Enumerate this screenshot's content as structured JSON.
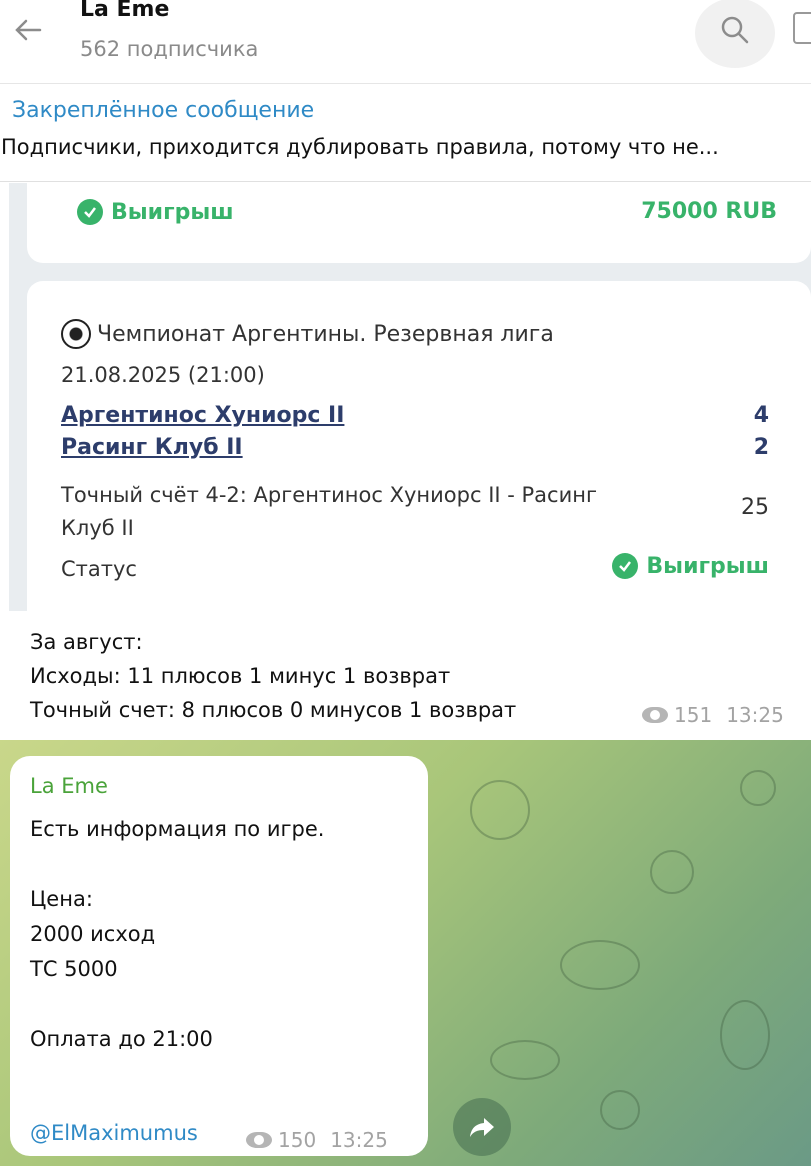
{
  "header": {
    "title": "La Eme",
    "subtitle": "562 подписчика"
  },
  "pinned": {
    "title": "Закреплённое сообщение",
    "text": "Подписчики, приходится дублировать правила, потому что не..."
  },
  "image_post": {
    "card1": {
      "status": "Выигрыш",
      "amount": "75000 RUB"
    },
    "card2": {
      "league": "Чемпионат Аргентины. Резервная лига",
      "date": "21.08.2025 (21:00)",
      "team1": "Аргентинос Хуниорс II",
      "score1": "4",
      "team2": "Расинг Клуб II",
      "score2": "2",
      "bet_line1": "Точный счёт 4-2: Аргентинос Хуниорс II - Расинг",
      "bet_line2": "Клуб II",
      "coefficient": "25",
      "status_label": "Статус",
      "status": "Выигрыш"
    }
  },
  "post1": {
    "lines": [
      "За август:",
      "Исходы: 11 плюсов 1 минус 1 возврат",
      "Точный счет: 8 плюсов 0 минусов 1 возврат"
    ],
    "views": "151",
    "time": "13:25"
  },
  "post2": {
    "sender": "La Eme",
    "text": "Есть информация по игре.\n\nЦена:\n2000 исход\nТС 5000\n\nОплата до 21:00",
    "link": "@ElMaximumus",
    "views": "150",
    "time": "13:25"
  },
  "colors": {
    "accent": "#2f8ac6",
    "win": "#38b36a",
    "team": "#2d3d6b",
    "sender": "#4aa33a"
  },
  "icons": [
    "back-arrow-icon",
    "search-icon",
    "more-icon",
    "check-icon",
    "soccer-ball-icon",
    "eye-icon",
    "share-icon"
  ]
}
